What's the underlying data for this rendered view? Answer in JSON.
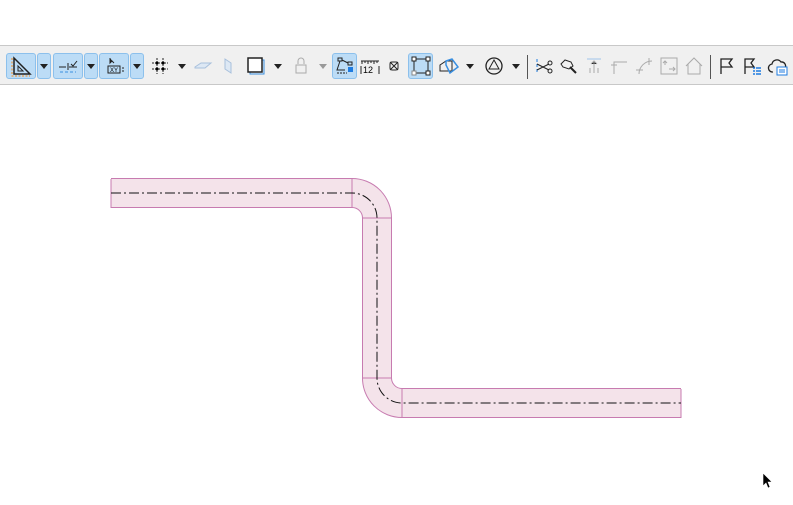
{
  "toolbar": {
    "tools": [
      {
        "name": "angle-guide-tool",
        "selected": true
      },
      {
        "name": "snap-guide-tool",
        "selected": true
      },
      {
        "name": "coordinate-input-tool",
        "selected": true
      },
      {
        "name": "grid-snap-tool",
        "selected": false
      },
      {
        "name": "layer-plane-tool",
        "disabled": true
      },
      {
        "name": "vertical-plane-tool",
        "disabled": true
      },
      {
        "name": "shadow-offset-tool",
        "selected": false
      },
      {
        "name": "lock-tool",
        "disabled": true
      },
      {
        "name": "suspend-groups-tool",
        "selected": true
      },
      {
        "name": "measure-tool",
        "label": "12"
      },
      {
        "name": "trace-tool"
      },
      {
        "name": "transform-tool",
        "selected": true
      },
      {
        "name": "3d-view-tool"
      },
      {
        "name": "renovation-filter-tool"
      },
      {
        "name": "split-tool"
      },
      {
        "name": "adjust-tool"
      },
      {
        "name": "extend-tool",
        "disabled": true
      },
      {
        "name": "fillet-tool",
        "disabled": true
      },
      {
        "name": "curve-tool",
        "disabled": true
      },
      {
        "name": "offset-tool",
        "disabled": true
      },
      {
        "name": "roof-tool",
        "disabled": true
      },
      {
        "name": "issue-flag-tool"
      },
      {
        "name": "issue-list-tool"
      },
      {
        "name": "cloud-markup-tool"
      }
    ]
  },
  "drawing": {
    "wall_fill": "#f4e3ea",
    "wall_edge": "#c77bb0",
    "accent": "#3a8fe0"
  }
}
